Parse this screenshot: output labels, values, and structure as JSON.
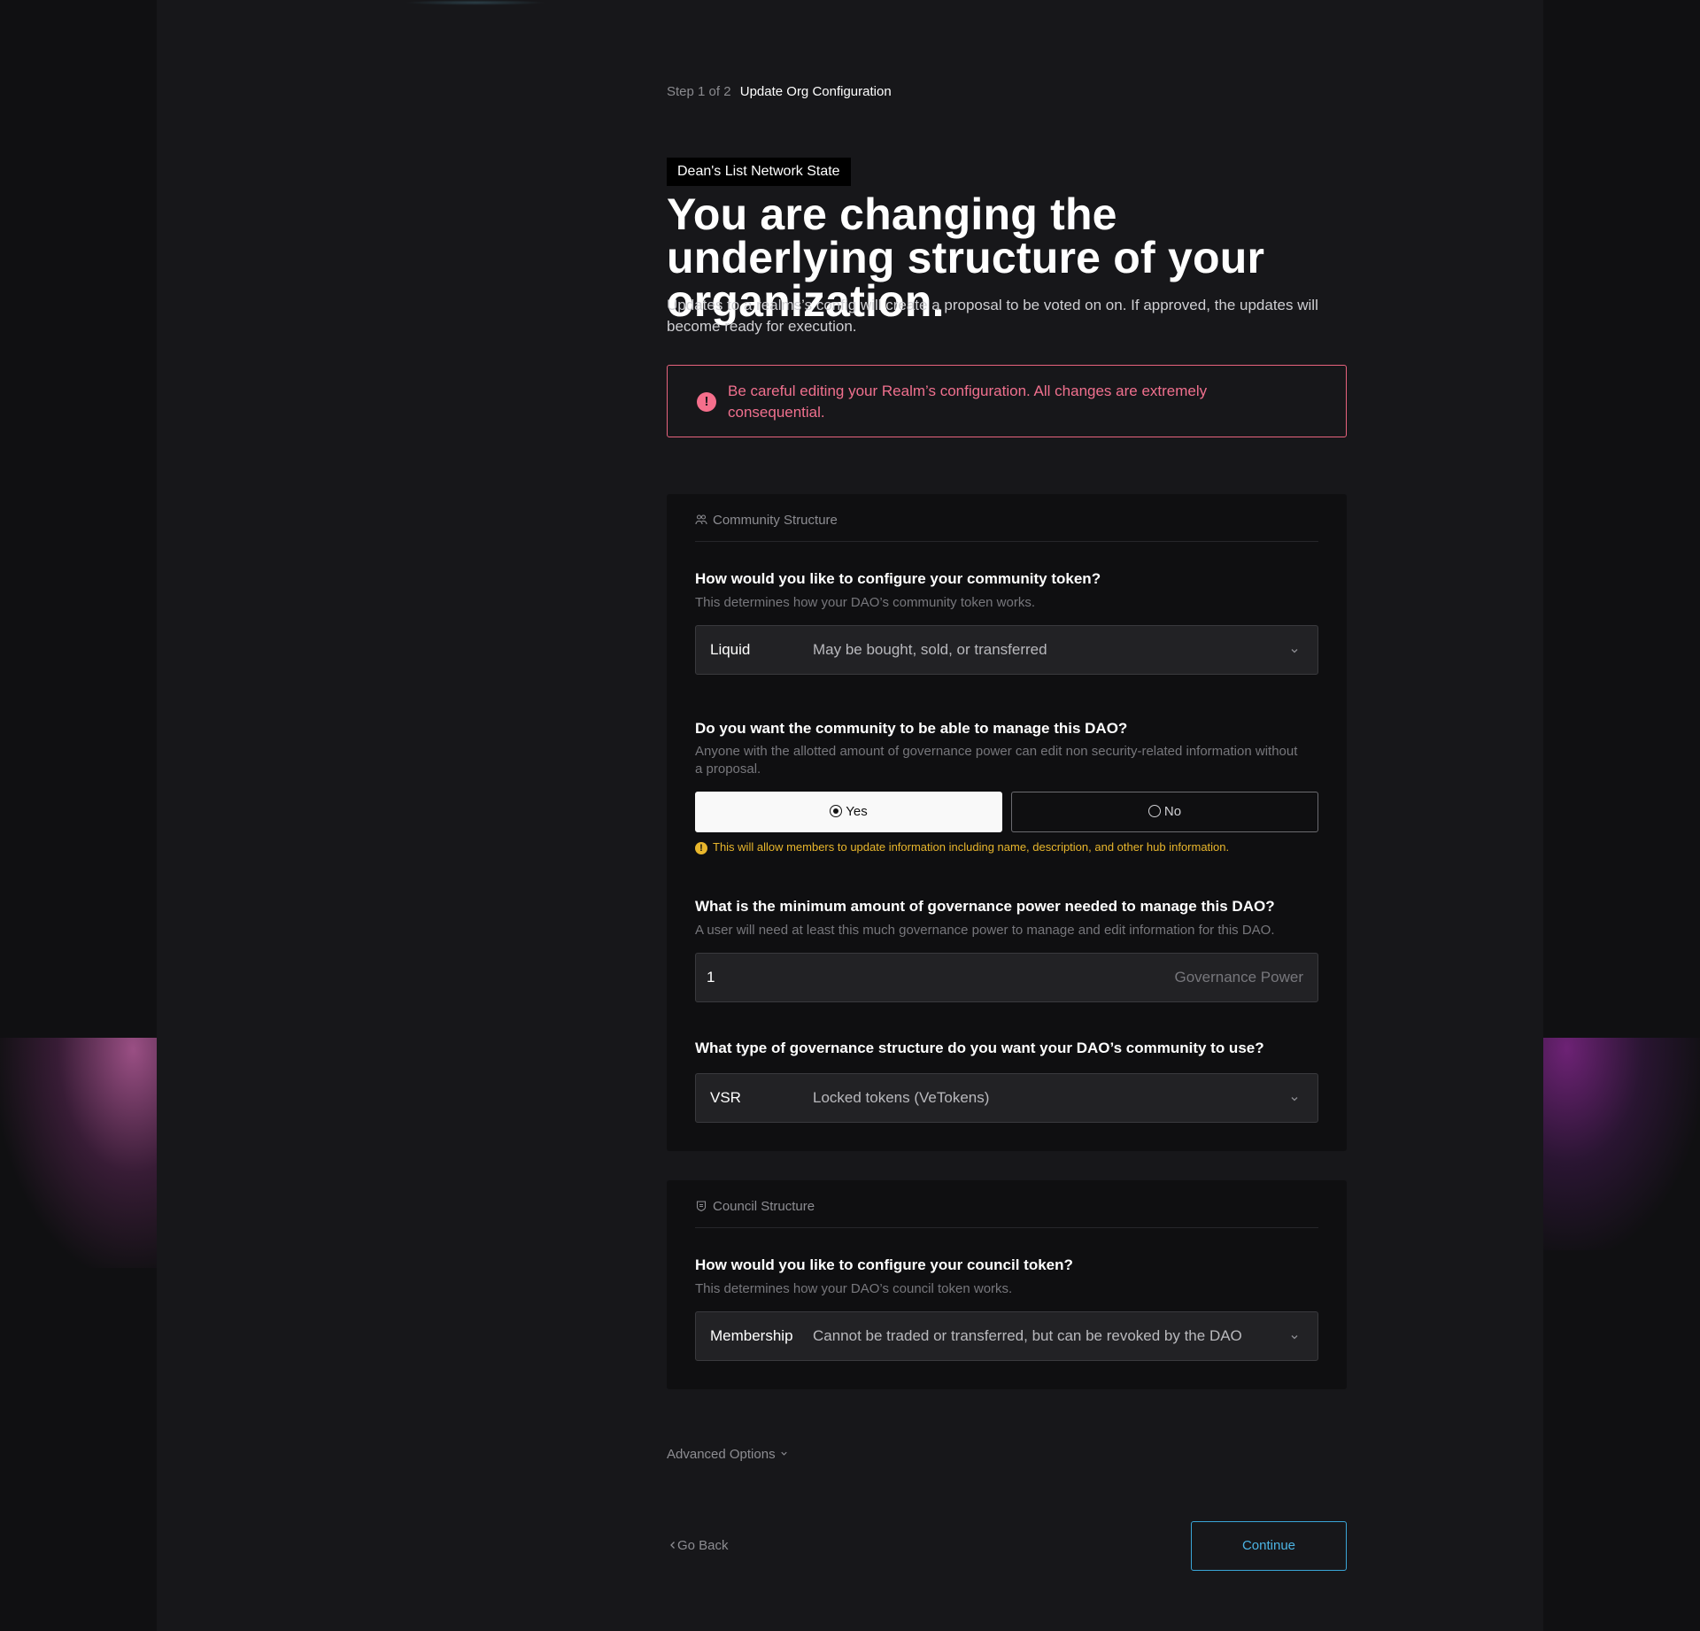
{
  "steps": {
    "progress": "Step 1 of 2",
    "title": "Update Org Configuration"
  },
  "org_name": "Dean's List Network State",
  "headline": "You are changing the underlying structure of your organization.",
  "subtitle": "Updates to a realms’s config will create a proposal to be voted on on. If approved, the updates will become ready for execution.",
  "warning": "Be careful editing your Realm’s configuration. All changes are extremely consequential.",
  "community": {
    "header": "Community Structure",
    "token_question": "How would you like to configure your community token?",
    "token_desc": "This determines how your DAO’s community token works.",
    "token_select": {
      "name": "Liquid",
      "description": "May be bought, sold, or transferred"
    },
    "manage_question": "Do you want the community to be able to manage this DAO?",
    "manage_desc": "Anyone with the allotted amount of governance power can edit non security-related information without a proposal.",
    "manage_options": {
      "yes": "Yes",
      "no": "No",
      "selected": "Yes"
    },
    "manage_hint": "This will allow members to update information including name, description, and other hub information.",
    "min_power_question": "What is the minimum amount of governance power needed to manage this DAO?",
    "min_power_desc": "A user will need at least this much governance power to manage and edit information for this DAO.",
    "min_power_value": "1",
    "min_power_suffix": "Governance Power",
    "gov_question": "What type of governance structure do you want your DAO’s community to use?",
    "gov_select": {
      "name": "VSR",
      "description": "Locked tokens (VeTokens)"
    }
  },
  "council": {
    "header": "Council Structure",
    "token_question": "How would you like to configure your council token?",
    "token_desc": "This determines how your DAO’s council token works.",
    "token_select": {
      "name": "Membership",
      "description": "Cannot be traded or transferred, but can be revoked by the DAO"
    }
  },
  "footer": {
    "advanced": "Advanced Options",
    "back": "Go Back",
    "continue": "Continue"
  },
  "colors": {
    "background": "#17171a",
    "card": "#0f0f11",
    "danger": "#f0708e",
    "warning": "#e8b62c",
    "accent": "#4cb4e4"
  },
  "icons": [
    "community-icon",
    "council-icon",
    "alert-icon",
    "chevron-down-icon",
    "chevron-left-icon",
    "radio-selected-icon",
    "radio-unselected-icon"
  ]
}
